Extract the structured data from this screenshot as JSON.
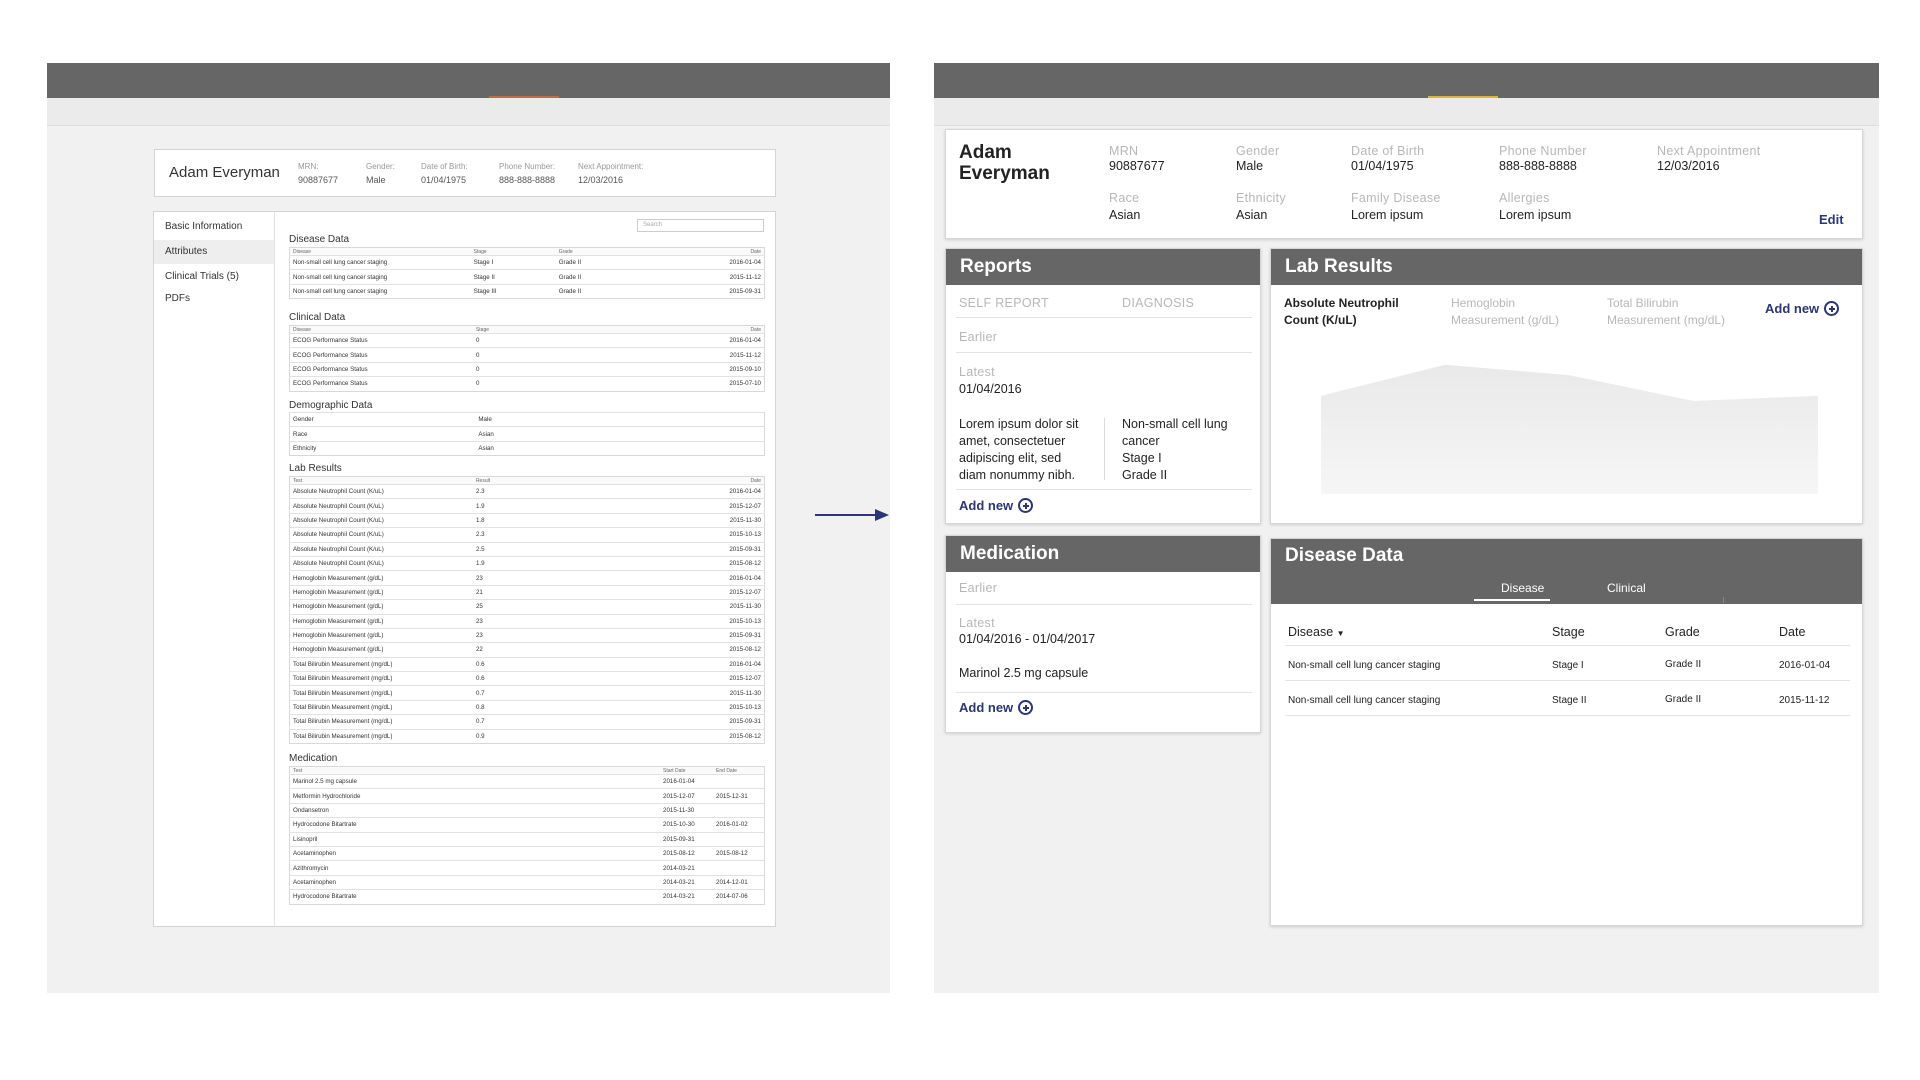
{
  "left": {
    "patient": {
      "name": "Adam Everyman",
      "fields": [
        {
          "label": "MRN:",
          "value": "90887677"
        },
        {
          "label": "Gender:",
          "value": "Male"
        },
        {
          "label": "Date of Birth:",
          "value": "01/04/1975"
        },
        {
          "label": "Phone Number:",
          "value": "888-888-8888"
        },
        {
          "label": "Next Appointment:",
          "value": "12/03/2016"
        }
      ]
    },
    "nav": [
      "Basic Information",
      "Attributes",
      "Clinical Trials (5)",
      "PDFs"
    ],
    "search_placeholder": "Search",
    "disease_data": {
      "title": "Disease Data",
      "headers": [
        "Disease",
        "Stage",
        "Grade",
        "Date"
      ],
      "rows": [
        [
          "Non-small cell lung cancer staging",
          "Stage I",
          "Grade II",
          "2016-01-04"
        ],
        [
          "Non-small cell lung cancer staging",
          "Stage II",
          "Grade II",
          "2015-11-12"
        ],
        [
          "Non-small cell lung cancer staging",
          "Stage III",
          "Grade II",
          "2015-09-31"
        ]
      ]
    },
    "clinical_data": {
      "title": "Clinical Data",
      "headers": [
        "Disease",
        "Stage",
        "Date"
      ],
      "rows": [
        [
          "ECOG Performance Status",
          "0",
          "2016-01-04"
        ],
        [
          "ECOG Performance Status",
          "0",
          "2015-11-12"
        ],
        [
          "ECOG Performance Status",
          "0",
          "2015-09-10"
        ],
        [
          "ECOG Performance Status",
          "0",
          "2015-07-10"
        ]
      ]
    },
    "demographic_data": {
      "title": "Demographic Data",
      "rows": [
        [
          "Gender",
          "Male"
        ],
        [
          "Race",
          "Asian"
        ],
        [
          "Ethnicity",
          "Asian"
        ]
      ]
    },
    "lab_results": {
      "title": "Lab Results",
      "headers": [
        "Test",
        "Result",
        "Date"
      ],
      "rows": [
        [
          "Absolute Neutrophil Count (K/uL)",
          "2.3",
          "2016-01-04"
        ],
        [
          "Absolute Neutrophil Count (K/uL)",
          "1.9",
          "2015-12-07"
        ],
        [
          "Absolute Neutrophil Count (K/uL)",
          "1.8",
          "2015-11-30"
        ],
        [
          "Absolute Neutrophil Count (K/uL)",
          "2.3",
          "2015-10-13"
        ],
        [
          "Absolute Neutrophil Count (K/uL)",
          "2.5",
          "2015-09-31"
        ],
        [
          "Absolute Neutrophil Count (K/uL)",
          "1.9",
          "2015-08-12"
        ],
        [
          "Hemoglobin Measurement (g/dL)",
          "23",
          "2016-01-04"
        ],
        [
          "Hemoglobin Measurement (g/dL)",
          "21",
          "2015-12-07"
        ],
        [
          "Hemoglobin Measurement (g/dL)",
          "25",
          "2015-11-30"
        ],
        [
          "Hemoglobin Measurement (g/dL)",
          "23",
          "2015-10-13"
        ],
        [
          "Hemoglobin Measurement (g/dL)",
          "23",
          "2015-09-31"
        ],
        [
          "Hemoglobin Measurement (g/dL)",
          "22",
          "2015-08-12"
        ],
        [
          "Total Bilirubin Measurement (mg/dL)",
          "0.6",
          "2016-01-04"
        ],
        [
          "Total Bilirubin Measurement (mg/dL)",
          "0.6",
          "2015-12-07"
        ],
        [
          "Total Bilirubin Measurement (mg/dL)",
          "0.7",
          "2015-11-30"
        ],
        [
          "Total Bilirubin Measurement (mg/dL)",
          "0.8",
          "2015-10-13"
        ],
        [
          "Total Bilirubin Measurement (mg/dL)",
          "0.7",
          "2015-09-31"
        ],
        [
          "Total Bilirubin Measurement (mg/dL)",
          "0.9",
          "2015-08-12"
        ]
      ]
    },
    "medication": {
      "title": "Medication",
      "headers": [
        "Test",
        "Start Date",
        "End Date"
      ],
      "rows": [
        [
          "Marinol 2.5 mg capsule",
          "2016-01-04",
          ""
        ],
        [
          "Metformin Hydrochloride",
          "2015-12-07",
          "2015-12-31"
        ],
        [
          "Ondansetron",
          "2015-11-30",
          ""
        ],
        [
          "Hydrocodone Bitartrate",
          "2015-10-30",
          "2016-01-02"
        ],
        [
          "Lisinopril",
          "2015-09-31",
          ""
        ],
        [
          "Acetaminophen",
          "2015-08-12",
          "2015-08-12"
        ],
        [
          "Azithromycin",
          "2014-03-21",
          ""
        ],
        [
          "Acetaminophen",
          "2014-03-21",
          "2014-12-01"
        ],
        [
          "Hydrocodone Bitartrate",
          "2014-03-21",
          "2014-07-06"
        ]
      ]
    }
  },
  "right": {
    "patient": {
      "name_line1": "Adam",
      "name_line2": "Everyman",
      "fields": [
        {
          "label": "MRN",
          "value": "90887677"
        },
        {
          "label": "Gender",
          "value": "Male"
        },
        {
          "label": "Date of Birth",
          "value": "01/04/1975"
        },
        {
          "label": "Phone Number",
          "value": "888-888-8888"
        },
        {
          "label": "Next Appointment",
          "value": "12/03/2016"
        },
        {
          "label": "Race",
          "value": "Asian"
        },
        {
          "label": "Ethnicity",
          "value": "Asian"
        },
        {
          "label": "Family Disease",
          "value": "Lorem ipsum"
        },
        {
          "label": "Allergies",
          "value": "Lorem ipsum"
        }
      ],
      "edit": "Edit"
    },
    "reports": {
      "title": "Reports",
      "tabs": [
        "SELF REPORT",
        "DIAGNOSIS"
      ],
      "earlier": "Earlier",
      "latest_label": "Latest",
      "latest_date": "01/04/2016",
      "self_report_text": [
        "Lorem ipsum dolor sit",
        "amet, consectetuer",
        "adipiscing elit, sed",
        "diam nonummy nibh."
      ],
      "diagnosis_text": [
        "Non-small cell lung",
        "cancer",
        "Stage I",
        "Grade II"
      ],
      "add_new": "Add new"
    },
    "lab_results": {
      "title": "Lab Results",
      "tabs": [
        "Absolute Neutrophil Count (K/uL)",
        "Hemoglobin Measurement (g/dL)",
        "Total Bilirubin Measurement (mg/dL)"
      ],
      "tab_lines": [
        [
          "Absolute Neutrophil",
          "Count (K/uL)"
        ],
        [
          "Hemoglobin",
          "Measurement (g/dL)"
        ],
        [
          "Total Bilirubin",
          "Measurement (mg/dL)"
        ]
      ],
      "add_new": "Add new"
    },
    "medication": {
      "title": "Medication",
      "earlier": "Earlier",
      "latest_label": "Latest",
      "latest_range": "01/04/2016 - 01/04/2017",
      "drug": "Marinol 2.5 mg capsule",
      "add_new": "Add new"
    },
    "disease_data": {
      "title": "Disease Data",
      "tabs": [
        "Disease",
        "Clinical"
      ],
      "headers": [
        "Disease",
        "Stage",
        "Grade",
        "Date"
      ],
      "rows": [
        [
          "Non-small cell lung cancer staging",
          "Stage I",
          "Grade II",
          "2016-01-04"
        ],
        [
          "Non-small cell lung cancer staging",
          "Stage II",
          "Grade II",
          "2015-11-12"
        ]
      ]
    }
  },
  "chart_data": {
    "type": "area",
    "series": [
      {
        "values": [
          1.9,
          2.5,
          2.3,
          1.8,
          1.9
        ]
      }
    ],
    "ylim": [
      0,
      3
    ]
  },
  "colors": {
    "header_bar": "#666666",
    "accent": "#2c3575",
    "background": "#f1f1f1"
  }
}
